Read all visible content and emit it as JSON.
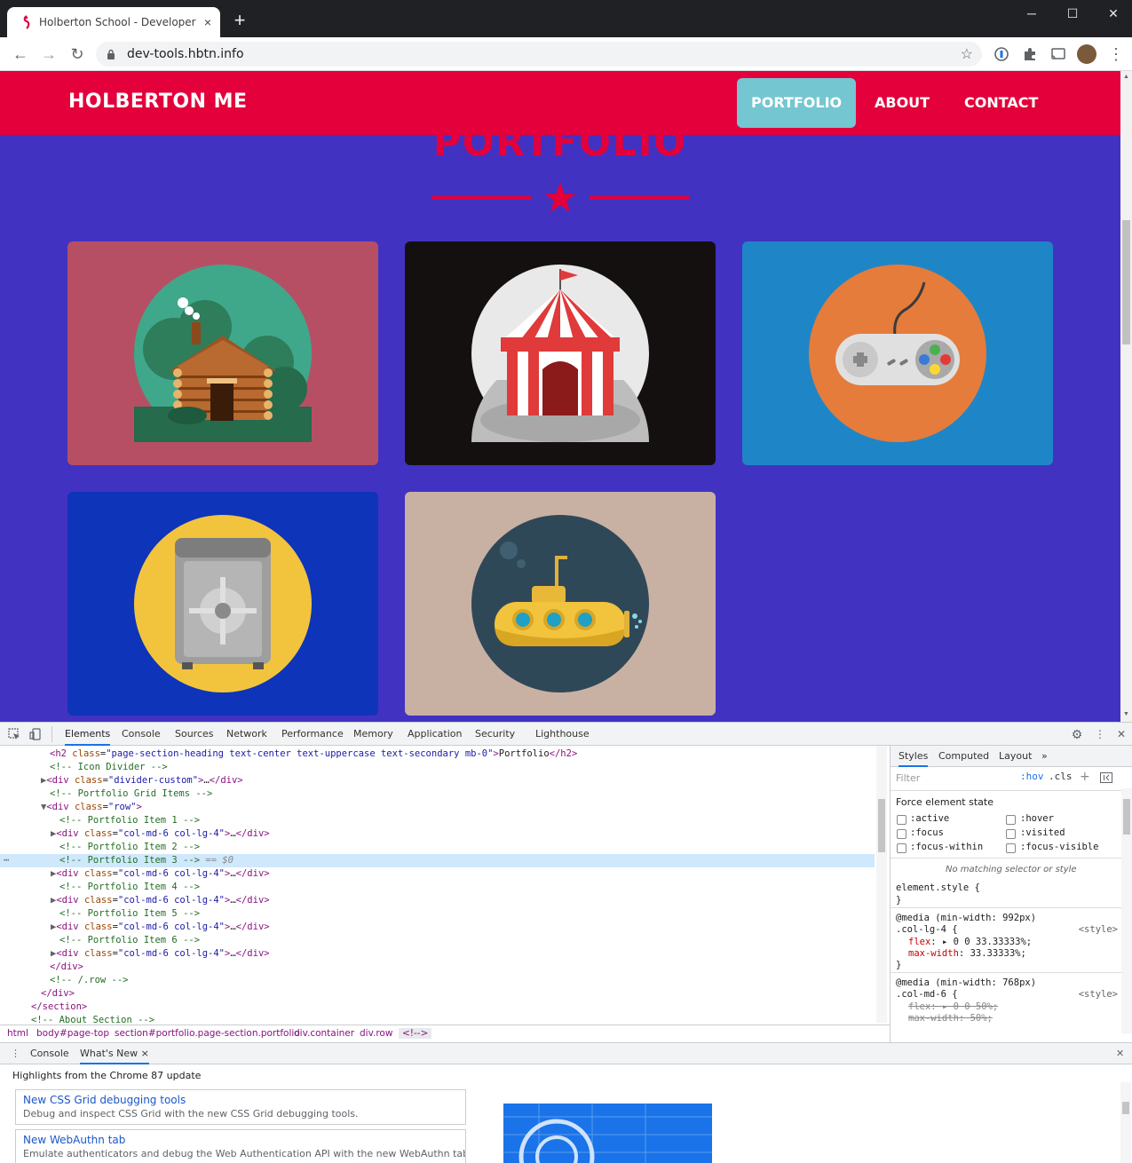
{
  "browser": {
    "tab_title": "Holberton School - Developer to",
    "tab_close": "×",
    "new_tab": "+",
    "url": "dev-tools.hbtn.info",
    "window_controls": {
      "minimize": "─",
      "maximize": "☐",
      "close": "✕"
    }
  },
  "site": {
    "brand": "HOLBERTON ME",
    "nav": [
      {
        "label": "PORTFOLIO",
        "active": true
      },
      {
        "label": "ABOUT",
        "active": false
      },
      {
        "label": "CONTACT",
        "active": false
      }
    ],
    "section_title": "PORTFOLIO",
    "portfolio_items": [
      {
        "name": "cabin",
        "bg": "#b74f64"
      },
      {
        "name": "circus",
        "bg": "#141010"
      },
      {
        "name": "game-controller",
        "bg": "#1e86c6"
      },
      {
        "name": "safe",
        "bg": "#0e34b9"
      },
      {
        "name": "submarine",
        "bg": "#c8b1a3"
      }
    ],
    "colors": {
      "primary": "#e3003b",
      "background": "#4232c2",
      "accent": "#74c7d1"
    }
  },
  "devtools": {
    "tabs": [
      "Elements",
      "Console",
      "Sources",
      "Network",
      "Performance",
      "Memory",
      "Application",
      "Security",
      "Lighthouse"
    ],
    "active_tab": "Elements",
    "dom_lines": [
      {
        "indent": 56,
        "html": "<span class='tok-tag'>&lt;h2</span> <span class='tok-attr'>class</span>=<span class='tok-val'>\"page-section-heading text-center text-uppercase text-secondary mb-0\"</span><span class='tok-tag'>&gt;</span><span class='tok-text'>Portfolio</span><span class='tok-tag'>&lt;/h2&gt;</span>"
      },
      {
        "indent": 56,
        "html": "<span class='tok-comment'>&lt;!-- Icon Divider --&gt;</span>"
      },
      {
        "indent": 46,
        "html": "<span class='tri'>▶</span><span class='tok-tag'>&lt;div</span> <span class='tok-attr'>class</span>=<span class='tok-val'>\"divider-custom\"</span><span class='tok-tag'>&gt;</span>…<span class='tok-tag'>&lt;/div&gt;</span>"
      },
      {
        "indent": 56,
        "html": "<span class='tok-comment'>&lt;!-- Portfolio Grid Items --&gt;</span>"
      },
      {
        "indent": 46,
        "html": "<span class='tri'>▼</span><span class='tok-tag'>&lt;div</span> <span class='tok-attr'>class</span>=<span class='tok-val'>\"row\"</span><span class='tok-tag'>&gt;</span>"
      },
      {
        "indent": 67,
        "html": "<span class='tok-comment'>&lt;!-- Portfolio Item 1 --&gt;</span>"
      },
      {
        "indent": 57,
        "html": "<span class='tri'>▶</span><span class='tok-tag'>&lt;div</span> <span class='tok-attr'>class</span>=<span class='tok-val'>\"col-md-6 col-lg-4\"</span><span class='tok-tag'>&gt;</span>…<span class='tok-tag'>&lt;/div&gt;</span>"
      },
      {
        "indent": 67,
        "html": "<span class='tok-comment'>&lt;!-- Portfolio Item 2 --&gt;</span>"
      },
      {
        "indent": 67,
        "html": "<span class='tok-comment'>&lt;!-- Portfolio Item 3 --&gt;</span> <span class='tok-dim'>== $0</span>",
        "selected": true
      },
      {
        "indent": 57,
        "html": "<span class='tri'>▶</span><span class='tok-tag'>&lt;div</span> <span class='tok-attr'>class</span>=<span class='tok-val'>\"col-md-6 col-lg-4\"</span><span class='tok-tag'>&gt;</span>…<span class='tok-tag'>&lt;/div&gt;</span>"
      },
      {
        "indent": 67,
        "html": "<span class='tok-comment'>&lt;!-- Portfolio Item 4 --&gt;</span>"
      },
      {
        "indent": 57,
        "html": "<span class='tri'>▶</span><span class='tok-tag'>&lt;div</span> <span class='tok-attr'>class</span>=<span class='tok-val'>\"col-md-6 col-lg-4\"</span><span class='tok-tag'>&gt;</span>…<span class='tok-tag'>&lt;/div&gt;</span>"
      },
      {
        "indent": 67,
        "html": "<span class='tok-comment'>&lt;!-- Portfolio Item 5 --&gt;</span>"
      },
      {
        "indent": 57,
        "html": "<span class='tri'>▶</span><span class='tok-tag'>&lt;div</span> <span class='tok-attr'>class</span>=<span class='tok-val'>\"col-md-6 col-lg-4\"</span><span class='tok-tag'>&gt;</span>…<span class='tok-tag'>&lt;/div&gt;</span>"
      },
      {
        "indent": 67,
        "html": "<span class='tok-comment'>&lt;!-- Portfolio Item 6 --&gt;</span>"
      },
      {
        "indent": 57,
        "html": "<span class='tri'>▶</span><span class='tok-tag'>&lt;div</span> <span class='tok-attr'>class</span>=<span class='tok-val'>\"col-md-6 col-lg-4\"</span><span class='tok-tag'>&gt;</span>…<span class='tok-tag'>&lt;/div&gt;</span>"
      },
      {
        "indent": 56,
        "html": "<span class='tok-tag'>&lt;/div&gt;</span>"
      },
      {
        "indent": 56,
        "html": "<span class='tok-comment'>&lt;!-- /.row --&gt;</span>"
      },
      {
        "indent": 46,
        "html": "<span class='tok-tag'>&lt;/div&gt;</span>"
      },
      {
        "indent": 35,
        "html": "<span class='tok-tag'>&lt;/section&gt;</span>"
      },
      {
        "indent": 35,
        "html": "<span class='tok-comment'>&lt;!-- About Section --&gt;</span>"
      }
    ],
    "breadcrumbs": [
      "html",
      "body#page-top",
      "section#portfolio.page-section.portfolio",
      "div.container",
      "div.row",
      "<!-->"
    ],
    "styles": {
      "tabs": [
        "Styles",
        "Computed",
        "Layout"
      ],
      "more": "»",
      "filter_placeholder": "Filter",
      "hov": ":hov",
      "cls": ".cls",
      "force_state_label": "Force element state",
      "states": [
        ":active",
        ":hover",
        ":focus",
        ":visited",
        ":focus-within",
        ":focus-visible"
      ],
      "no_match": "No matching selector or style",
      "element_style": "element.style {",
      "close_brace": "}",
      "media1": "@media (min-width: 992px)",
      "rule1_selector": ".col-lg-4 {",
      "rule1_source": "<style>",
      "rule1_props": [
        {
          "name": "flex",
          "value": "▸ 0 0 33.33333%;"
        },
        {
          "name": "max-width",
          "value": "33.33333%;"
        }
      ],
      "media2": "@media (min-width: 768px)",
      "rule2_selector": ".col-md-6 {",
      "rule2_source": "<style>",
      "rule2_props": [
        {
          "name": "flex",
          "value": "▸ 0 0 50%;"
        },
        {
          "name": "max-width",
          "value": "50%;"
        }
      ]
    },
    "drawer": {
      "tabs": [
        "Console",
        "What's New"
      ],
      "active_tab": "What's New",
      "close": "×",
      "highlights": "Highlights from the Chrome 87 update",
      "news": [
        {
          "title": "New CSS Grid debugging tools",
          "desc": "Debug and inspect CSS Grid with the new CSS Grid debugging tools."
        },
        {
          "title": "New WebAuthn tab",
          "desc": "Emulate authenticators and debug the Web Authentication API with the new WebAuthn tab."
        }
      ]
    }
  }
}
